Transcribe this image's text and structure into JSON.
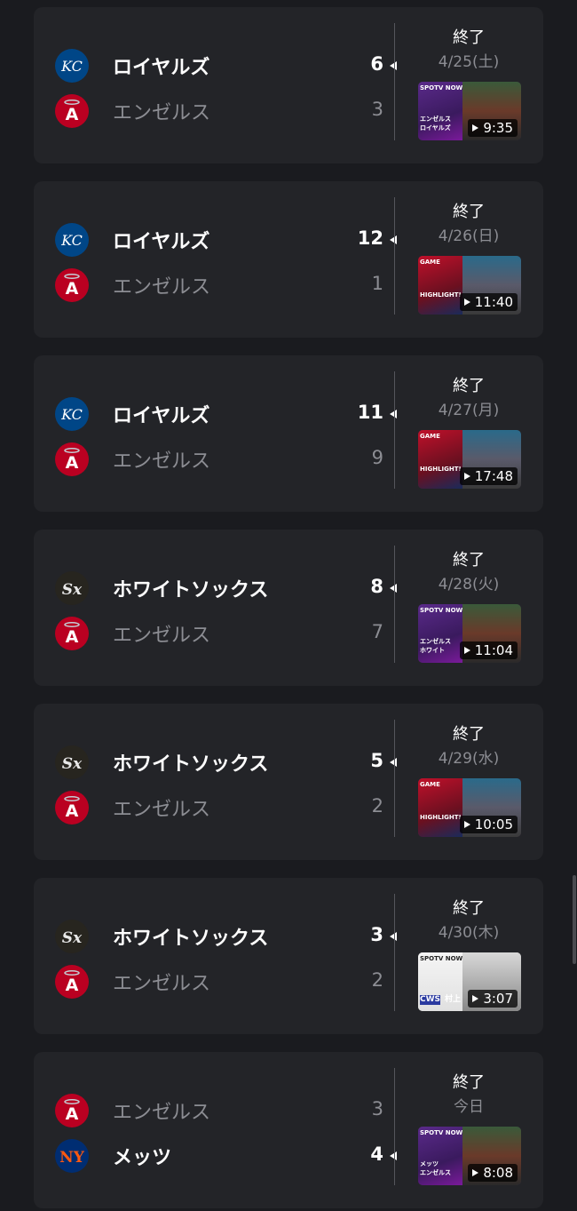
{
  "games": [
    {
      "top": {
        "team": "ロイヤルズ",
        "logo": "kc-royals-logo",
        "score": "6",
        "winner": true
      },
      "bottom": {
        "team": "エンゼルス",
        "logo": "la-angels-logo",
        "score": "3",
        "winner": false
      },
      "status": "終了",
      "date": "4/25(土)",
      "video": {
        "duration": "9:35",
        "style": "spotv",
        "caption1": "SPOTV NOW",
        "caption2": "エンゼルス",
        "caption3": "ロイヤルズ"
      }
    },
    {
      "top": {
        "team": "ロイヤルズ",
        "logo": "kc-royals-logo",
        "score": "12",
        "winner": true
      },
      "bottom": {
        "team": "エンゼルス",
        "logo": "la-angels-logo",
        "score": "1",
        "winner": false
      },
      "status": "終了",
      "date": "4/26(日)",
      "video": {
        "duration": "11:40",
        "style": "mlb",
        "caption1": "GAME",
        "caption2": "HIGHLIGHT!",
        "caption3": ""
      }
    },
    {
      "top": {
        "team": "ロイヤルズ",
        "logo": "kc-royals-logo",
        "score": "11",
        "winner": true
      },
      "bottom": {
        "team": "エンゼルス",
        "logo": "la-angels-logo",
        "score": "9",
        "winner": false
      },
      "status": "終了",
      "date": "4/27(月)",
      "video": {
        "duration": "17:48",
        "style": "mlb",
        "caption1": "GAME",
        "caption2": "HIGHLIGHT!",
        "caption3": ""
      }
    },
    {
      "top": {
        "team": "ホワイトソックス",
        "logo": "cws-white-sox-logo",
        "score": "8",
        "winner": true
      },
      "bottom": {
        "team": "エンゼルス",
        "logo": "la-angels-logo",
        "score": "7",
        "winner": false
      },
      "status": "終了",
      "date": "4/28(火)",
      "video": {
        "duration": "11:04",
        "style": "spotv",
        "caption1": "SPOTV NOW",
        "caption2": "エンゼルス",
        "caption3": "ホワイト"
      }
    },
    {
      "top": {
        "team": "ホワイトソックス",
        "logo": "cws-white-sox-logo",
        "score": "5",
        "winner": true
      },
      "bottom": {
        "team": "エンゼルス",
        "logo": "la-angels-logo",
        "score": "2",
        "winner": false
      },
      "status": "終了",
      "date": "4/29(水)",
      "video": {
        "duration": "10:05",
        "style": "mlb",
        "caption1": "GAME",
        "caption2": "HIGHLIGHT!",
        "caption3": ""
      }
    },
    {
      "top": {
        "team": "ホワイトソックス",
        "logo": "cws-white-sox-logo",
        "score": "3",
        "winner": true
      },
      "bottom": {
        "team": "エンゼルス",
        "logo": "la-angels-logo",
        "score": "2",
        "winner": false
      },
      "status": "終了",
      "date": "4/30(木)",
      "video": {
        "duration": "3:07",
        "style": "white",
        "caption1": "SPOTV NOW",
        "caption2": "CWS",
        "caption3": "村上"
      }
    },
    {
      "top": {
        "team": "エンゼルス",
        "logo": "la-angels-logo",
        "score": "3",
        "winner": false
      },
      "bottom": {
        "team": "メッツ",
        "logo": "ny-mets-logo",
        "score": "4",
        "winner": true
      },
      "status": "終了",
      "date": "今日",
      "video": {
        "duration": "8:08",
        "style": "spotv",
        "caption1": "SPOTV NOW",
        "caption2": "メッツ",
        "caption3": "エンゼルス"
      }
    }
  ],
  "colors": {
    "background": "#1a1b1f",
    "card": "#232428",
    "royals": "#004687",
    "angels": "#ba0021",
    "whitesox": "#27251f",
    "mets": "#002d72",
    "metsOrange": "#ff5910"
  }
}
